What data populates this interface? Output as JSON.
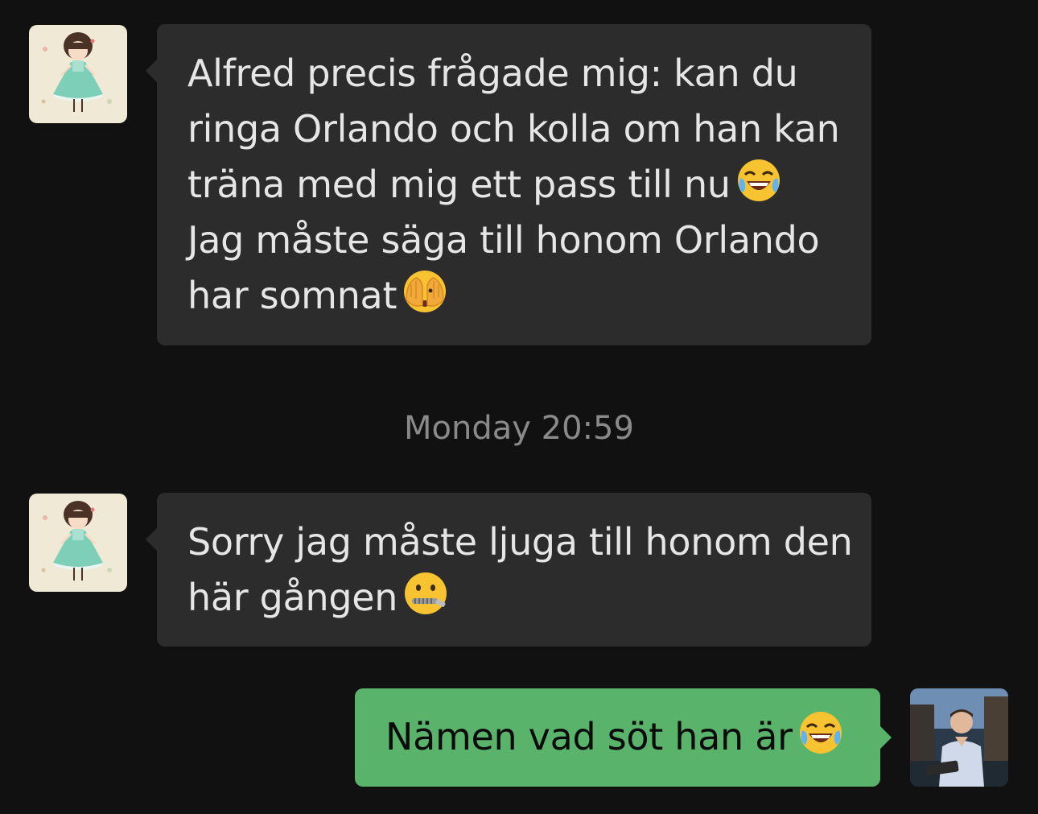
{
  "messages": [
    {
      "sender": "incoming",
      "avatar_icon": "girl-in-green-dress-avatar",
      "lines": [
        "Alfred precis frågade mig: kan du",
        "ringa Orlando och kolla om han kan",
        "träna med mig ett pass till nu",
        "Jag måste säga till honom Orlando",
        "har somnat"
      ],
      "emojis": [
        "face-with-tears-of-joy",
        "face-with-hands-over-eyes"
      ]
    },
    {
      "sender": "incoming",
      "avatar_icon": "girl-in-green-dress-avatar",
      "lines": [
        "Sorry jag måste ljuga till honom den",
        "här gången"
      ],
      "emojis": [
        "zipper-mouth-face"
      ]
    },
    {
      "sender": "outgoing",
      "avatar_icon": "user-photo-avatar",
      "lines": [
        "Nämen vad söt han är"
      ],
      "emojis": [
        "face-with-tears-of-joy"
      ]
    }
  ],
  "timestamp": "Monday 20:59",
  "colors": {
    "background": "#111111",
    "incoming_bubble": "#2c2c2c",
    "outgoing_bubble": "#5ab36a",
    "timestamp_text": "#8a8a8a"
  }
}
